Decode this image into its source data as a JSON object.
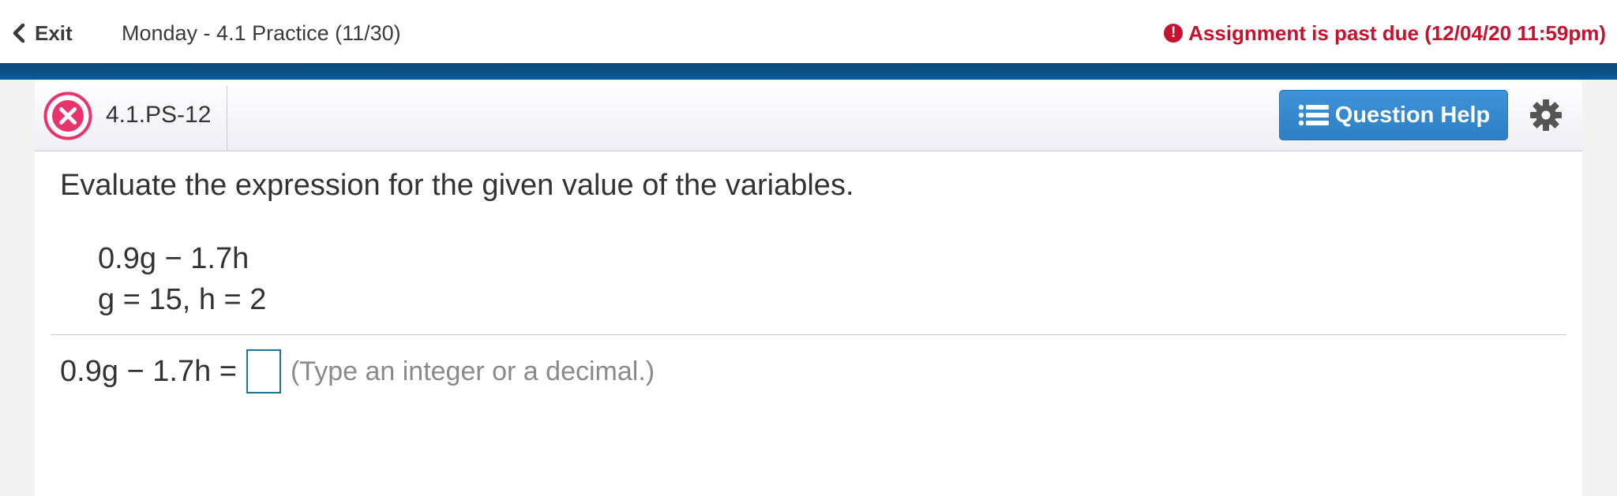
{
  "topbar": {
    "exit_label": "Exit",
    "assignment_title": "Monday - 4.1 Practice (11/30)",
    "past_due_text": "Assignment is past due (12/04/20 11:59pm)",
    "past_due_icon": "alert-circle-icon",
    "past_due_color": "#c4122f"
  },
  "question": {
    "status_icon": "incorrect-x-icon",
    "id": "4.1.PS-12",
    "help_button_label": "Question Help",
    "help_button_icon": "list-icon",
    "settings_icon": "gear-icon",
    "instruction": "Evaluate the expression for the given value of the variables.",
    "expression": "0.9g − 1.7h",
    "given_values": "g = 15, h = 2",
    "answer_prompt": "0.9g − 1.7h =",
    "answer_value": "",
    "answer_hint": "(Type an integer or a decimal.)"
  },
  "colors": {
    "header_blue": "#0b5a92",
    "button_blue": "#3a8bd0",
    "input_border": "#1f7391",
    "incorrect_pink": "#e8336d"
  }
}
